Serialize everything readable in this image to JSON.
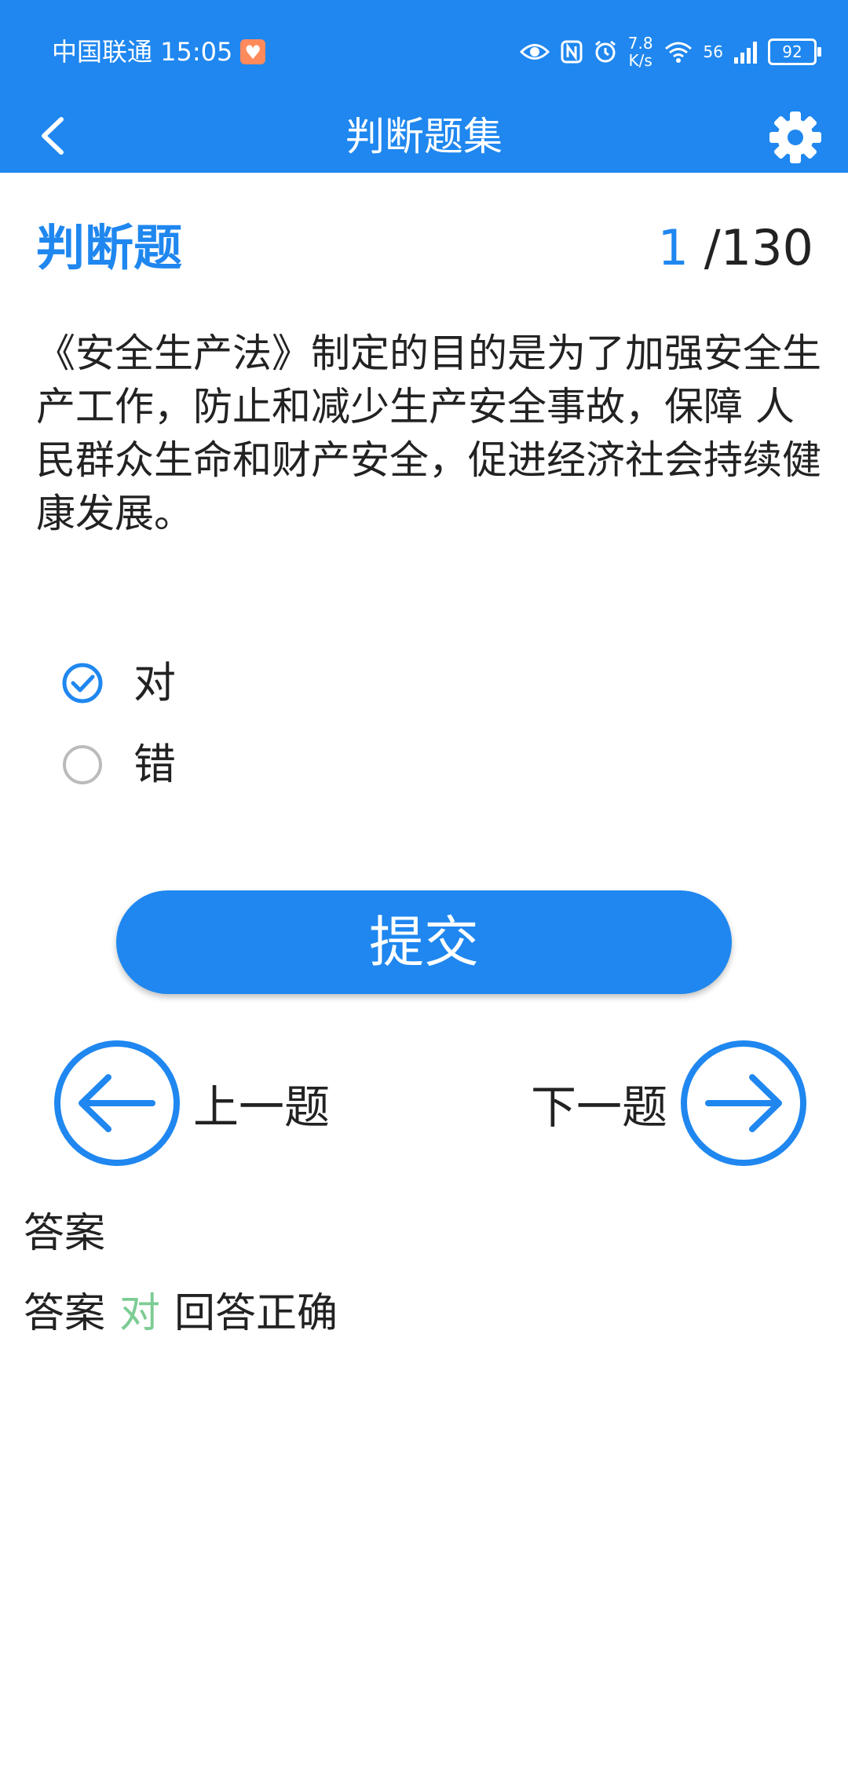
{
  "status_bar": {
    "carrier_time": "中国联通 15:05",
    "net_speed_value": "7.8",
    "net_speed_unit": "K/s",
    "network_type": "56",
    "battery": "92"
  },
  "app_bar": {
    "title": "判断题集"
  },
  "question": {
    "type_label": "判断题",
    "current": "1",
    "total": "/130",
    "text": "《安全生产法》制定的目的是为了加强安全生产工作，防止和减少生产安全事故，保障 人民群众生命和财产安全，促进经济社会持续健康发展。"
  },
  "options": [
    {
      "label": "对",
      "selected": true
    },
    {
      "label": "错",
      "selected": false
    }
  ],
  "submit_label": "提交",
  "navigation": {
    "prev_label": "上一题",
    "next_label": "下一题"
  },
  "answer": {
    "heading": "答案",
    "prefix": "答案",
    "value": "对",
    "result": "回答正确"
  },
  "colors": {
    "primary": "#1f87ef",
    "correct": "#7ccc94",
    "unselected": "#bbbbbb"
  }
}
